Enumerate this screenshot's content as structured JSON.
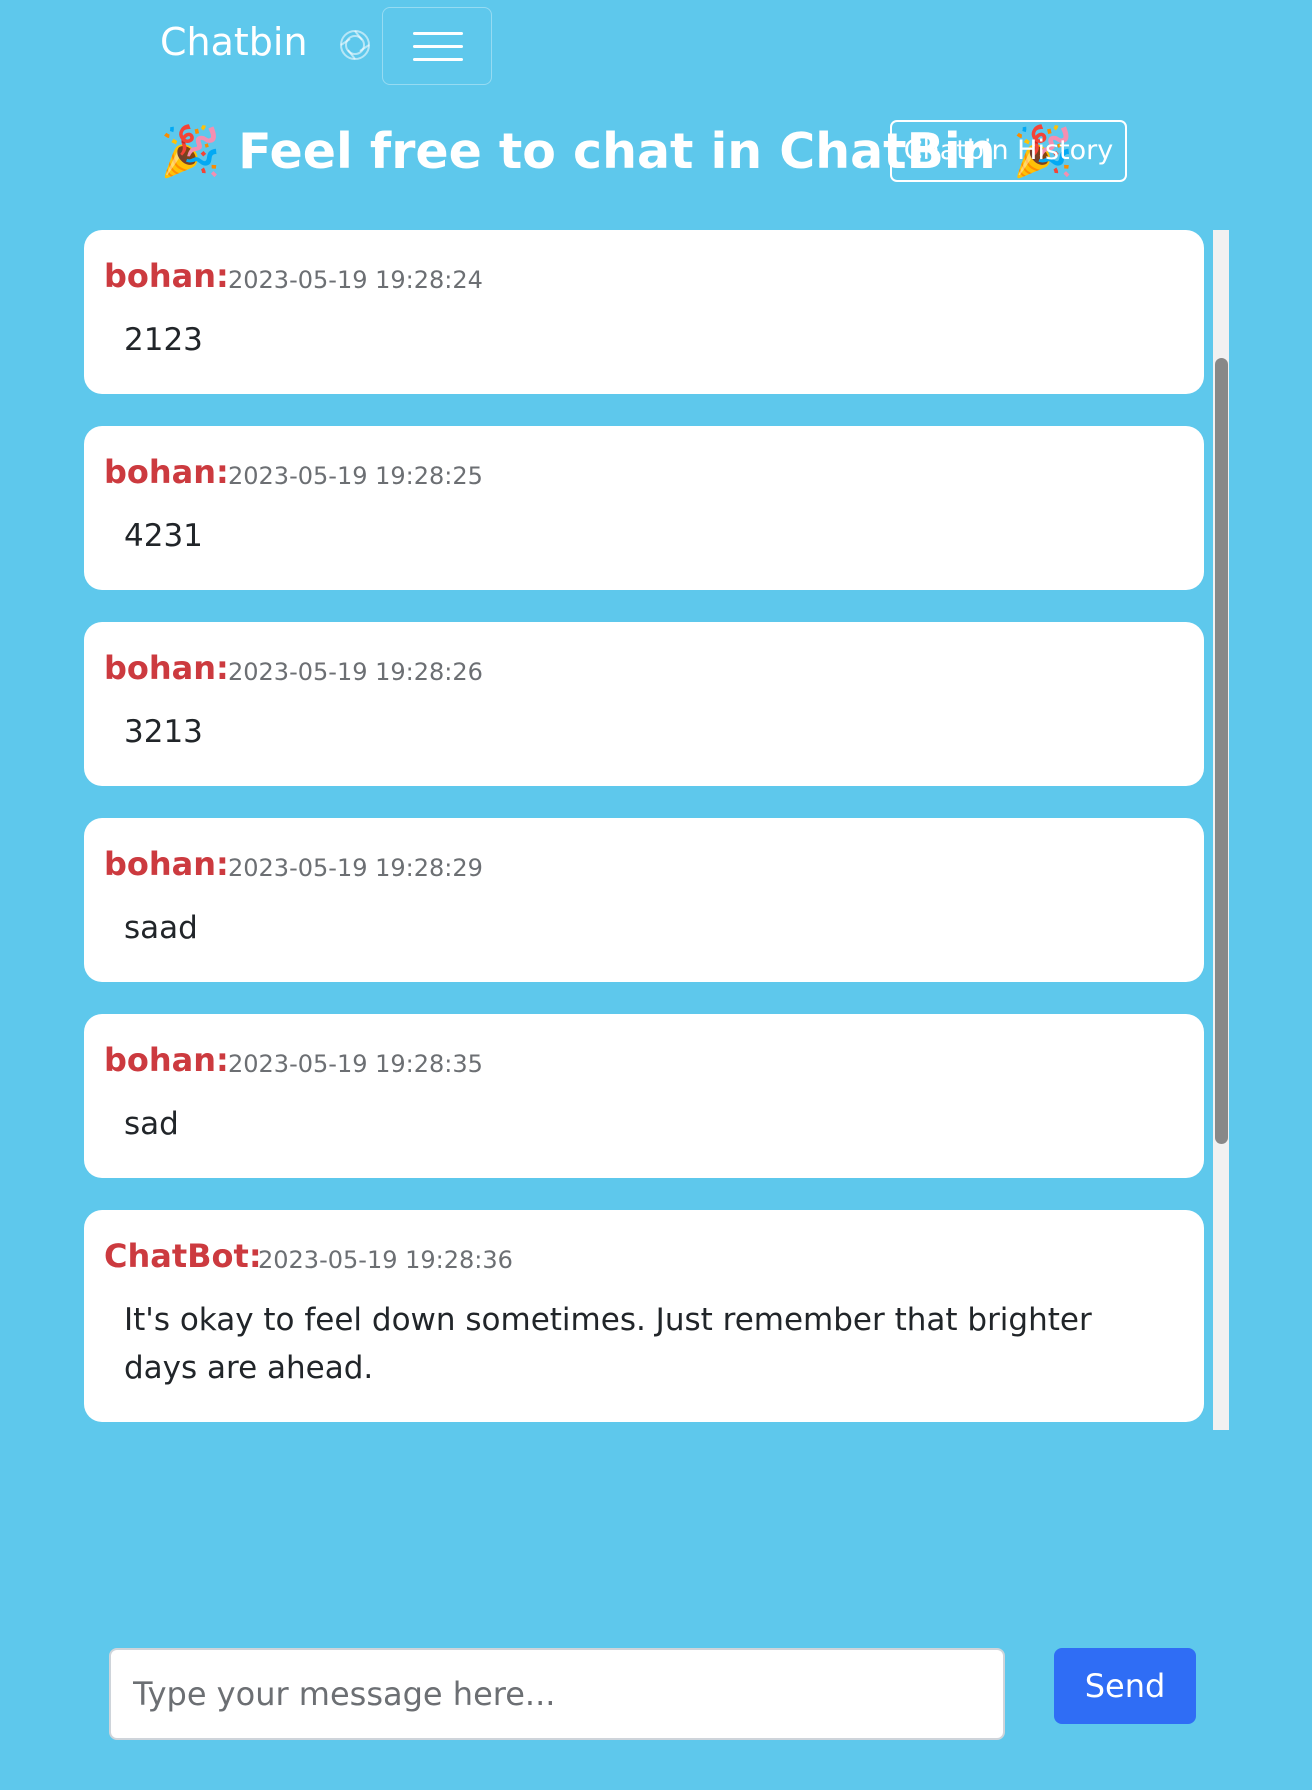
{
  "navbar": {
    "brand": "Chatbin",
    "loading_icon": "spinner-icon",
    "menu_icon": "hamburger-menu-icon"
  },
  "header": {
    "title": "🎉 Feel free to chat in ChatBin 🎉",
    "history_button": "Chatbin History"
  },
  "messages": [
    {
      "sender": "bohan:",
      "time": "2023-05-19 19:28:24",
      "text": "2123"
    },
    {
      "sender": "bohan:",
      "time": "2023-05-19 19:28:25",
      "text": "4231"
    },
    {
      "sender": "bohan:",
      "time": "2023-05-19 19:28:26",
      "text": "3213"
    },
    {
      "sender": "bohan:",
      "time": "2023-05-19 19:28:29",
      "text": "saad"
    },
    {
      "sender": "bohan:",
      "time": "2023-05-19 19:28:35",
      "text": "sad"
    },
    {
      "sender": "ChatBot:",
      "time": "2023-05-19 19:28:36",
      "text": "It's okay to feel down sometimes. Just remember that brighter days are ahead."
    }
  ],
  "composer": {
    "placeholder": "Type your message here...",
    "value": "",
    "send_label": "Send"
  },
  "colors": {
    "background": "#5ec8ec",
    "sender": "#cc3a3f",
    "send_button": "#2f6df5"
  }
}
